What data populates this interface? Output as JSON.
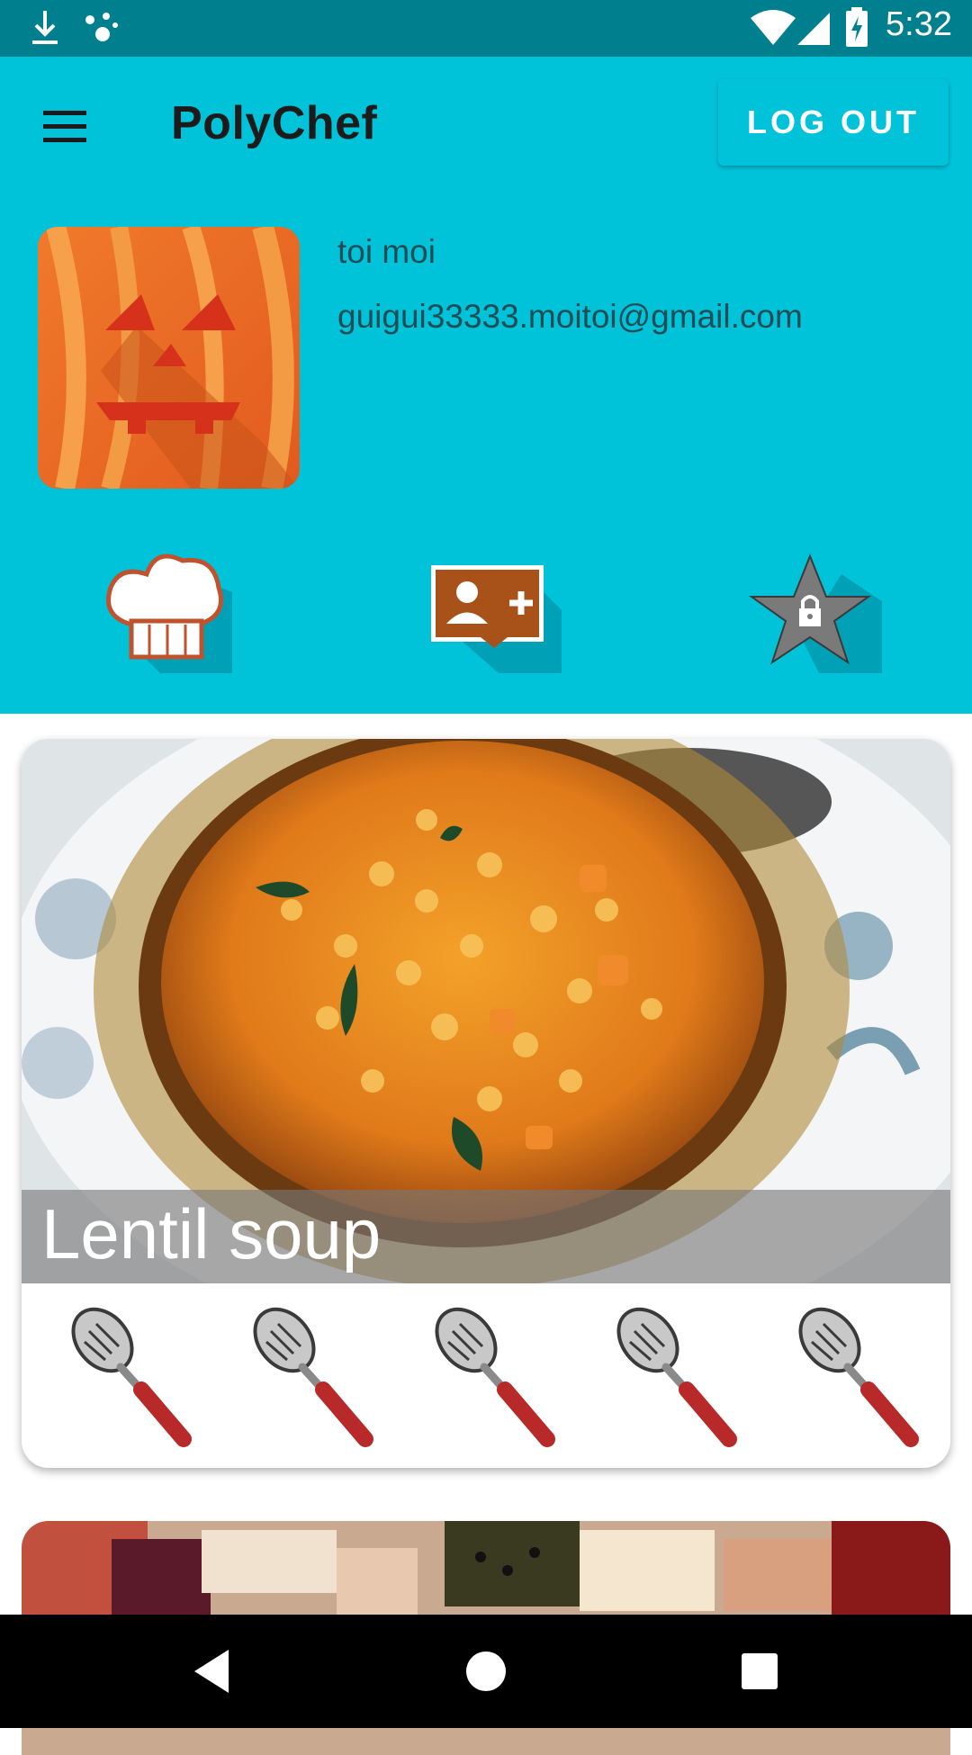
{
  "status_bar": {
    "time": "5:32",
    "icons": [
      "download-icon",
      "assistant-dots-icon",
      "wifi-icon",
      "signal-icon",
      "battery-charging-icon"
    ]
  },
  "app_bar": {
    "title": "PolyChef",
    "menu_icon": "hamburger-menu-icon",
    "logout_label": "LOG OUT"
  },
  "profile": {
    "name": "toi moi",
    "email": "guigui33333.moitoi@gmail.com",
    "avatar_icon": "pumpkin-avatar-icon"
  },
  "profile_actions": [
    {
      "icon": "chef-hat-icon"
    },
    {
      "icon": "add-friend-icon"
    },
    {
      "icon": "locked-star-icon"
    }
  ],
  "recipes": [
    {
      "title": "Lentil soup",
      "rating": 5,
      "rating_max": 5,
      "rating_icon": "spoon-rating-icon"
    },
    {
      "title": ""
    }
  ],
  "colors": {
    "status_bar": "#00808f",
    "primary": "#00c2d9",
    "text_dark": "#1e4d55",
    "title_band": "#7a7a7a",
    "nav_bar": "#000000"
  },
  "nav_bar": {
    "icons": [
      "back-icon",
      "home-icon",
      "recents-icon"
    ]
  }
}
